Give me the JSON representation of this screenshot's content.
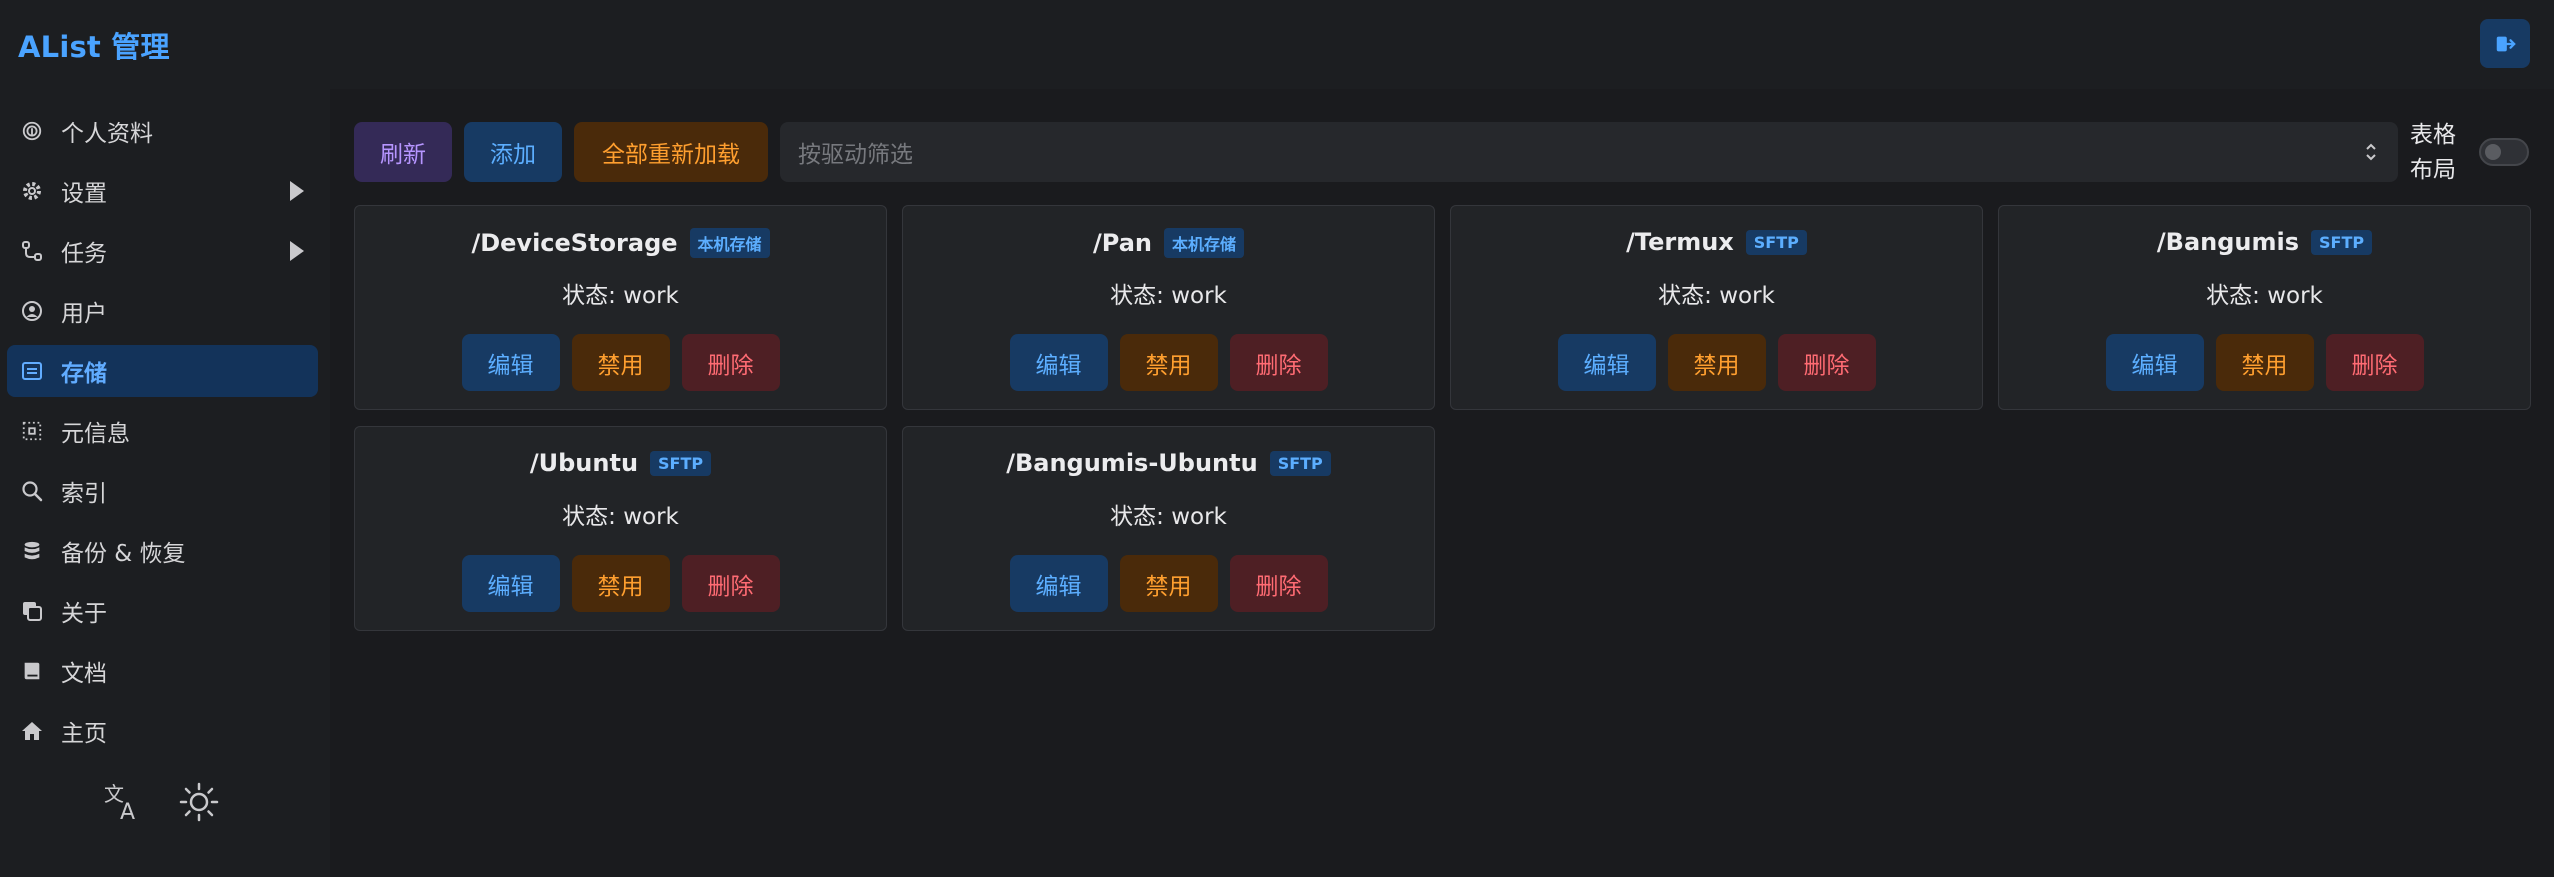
{
  "app": {
    "title": "AList 管理"
  },
  "colors": {
    "accent": "#4aa3ff",
    "active_bg": "#13335a",
    "warning": "#ff9f2f",
    "danger": "#ff6b73",
    "purple": "#b695ff"
  },
  "sidebar": {
    "items": [
      {
        "label": "个人资料",
        "icon": "fingerprint-icon",
        "active": false,
        "expandable": false
      },
      {
        "label": "设置",
        "icon": "gear-icon",
        "active": false,
        "expandable": true
      },
      {
        "label": "任务",
        "icon": "route-icon",
        "active": false,
        "expandable": true
      },
      {
        "label": "用户",
        "icon": "user-circle-icon",
        "active": false,
        "expandable": false
      },
      {
        "label": "存储",
        "icon": "storage-icon",
        "active": true,
        "expandable": false
      },
      {
        "label": "元信息",
        "icon": "metadata-icon",
        "active": false,
        "expandable": false
      },
      {
        "label": "索引",
        "icon": "search-icon",
        "active": false,
        "expandable": false
      },
      {
        "label": "备份 & 恢复",
        "icon": "database-icon",
        "active": false,
        "expandable": false
      },
      {
        "label": "关于",
        "icon": "copy-icon",
        "active": false,
        "expandable": false
      },
      {
        "label": "文档",
        "icon": "book-icon",
        "active": false,
        "expandable": false
      },
      {
        "label": "主页",
        "icon": "home-icon",
        "active": false,
        "expandable": false
      }
    ],
    "bottom_icons": [
      "translate-icon",
      "sun-icon"
    ]
  },
  "toolbar": {
    "refresh_label": "刷新",
    "add_label": "添加",
    "reload_all_label": "全部重新加载",
    "filter_placeholder": "按驱动筛选",
    "layout_label_line1": "表格",
    "layout_label_line2": "布局",
    "table_layout_on": false
  },
  "storages": [
    {
      "path": "/DeviceStorage",
      "driver": "本机存储",
      "status": "状态: work",
      "edit": "编辑",
      "disable": "禁用",
      "delete": "删除"
    },
    {
      "path": "/Pan",
      "driver": "本机存储",
      "status": "状态: work",
      "edit": "编辑",
      "disable": "禁用",
      "delete": "删除"
    },
    {
      "path": "/Termux",
      "driver": "SFTP",
      "status": "状态: work",
      "edit": "编辑",
      "disable": "禁用",
      "delete": "删除"
    },
    {
      "path": "/Bangumis",
      "driver": "SFTP",
      "status": "状态: work",
      "edit": "编辑",
      "disable": "禁用",
      "delete": "删除"
    },
    {
      "path": "/Ubuntu",
      "driver": "SFTP",
      "status": "状态: work",
      "edit": "编辑",
      "disable": "禁用",
      "delete": "删除"
    },
    {
      "path": "/Bangumis-Ubuntu",
      "driver": "SFTP",
      "status": "状态: work",
      "edit": "编辑",
      "disable": "禁用",
      "delete": "删除"
    }
  ]
}
